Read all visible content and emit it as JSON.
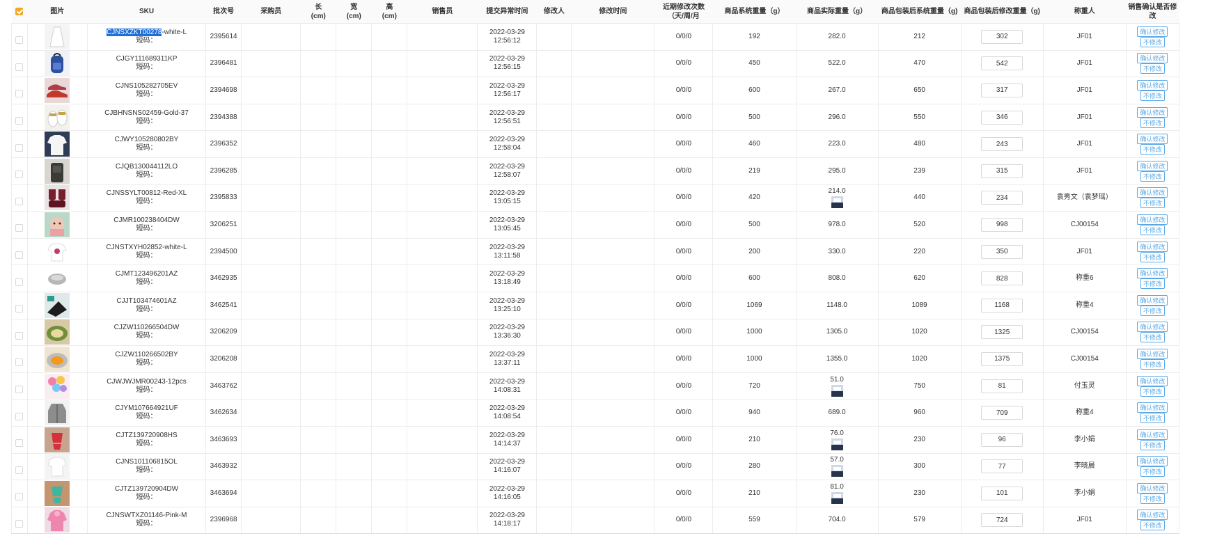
{
  "headers": {
    "image": "图片",
    "sku": "SKU",
    "batch": "批次号",
    "buyer": "采购员",
    "length": "长\n(cm)",
    "width": "宽\n(cm)",
    "height": "高\n(cm)",
    "seller": "销售员",
    "submit_time": "提交异常时间",
    "modifier": "修改人",
    "modify_time": "修改时间",
    "recent_count": "近期修改次数（天/周/月",
    "sys_weight": "商品系统重量（g）",
    "actual_weight": "商品实际重量（g）",
    "pkg_sys_weight": "商品包装后系统重量（g)",
    "pkg_mod_weight": "商品包装后修改重量（g)",
    "weigher": "称重人",
    "confirm": "销售确认是否修改"
  },
  "labels": {
    "short_code": "短码：",
    "confirm_btn": "确认修改",
    "reject_btn": "不修改"
  },
  "colors": {
    "accent": "#f5a623",
    "link": "#5aa9e6",
    "highlight": "#1e6fd9"
  },
  "rows": [
    {
      "sku_hl": "CJNSXZKT00278",
      "sku_rest": "-white-L",
      "batch": "2395614",
      "date": "2022-03-29",
      "time": "12:56:12",
      "count": "0/0/0",
      "sys": "192",
      "actual": "282.0",
      "pkg_sys": "212",
      "pkg_mod": "302",
      "weigher": "JF01",
      "img": "dress-icon",
      "has_mini": false
    },
    {
      "sku_hl": "",
      "sku_rest": "CJGY111689311KP",
      "batch": "2396481",
      "date": "2022-03-29",
      "time": "12:56:15",
      "count": "0/0/0",
      "sys": "450",
      "actual": "522.0",
      "pkg_sys": "470",
      "pkg_mod": "542",
      "weigher": "JF01",
      "img": "backpack-icon",
      "has_mini": false
    },
    {
      "sku_hl": "",
      "sku_rest": "CJNS105282705EV",
      "batch": "2394698",
      "date": "2022-03-29",
      "time": "12:56:17",
      "count": "0/0/0",
      "sys": "600",
      "actual": "267.0",
      "pkg_sys": "650",
      "pkg_mod": "317",
      "weigher": "JF01",
      "img": "shoes-icon",
      "has_mini": false
    },
    {
      "sku_hl": "",
      "sku_rest": "CJBHNSNS02459-Gold-37",
      "batch": "2394388",
      "date": "2022-03-29",
      "time": "12:56:51",
      "count": "0/0/0",
      "sys": "500",
      "actual": "296.0",
      "pkg_sys": "550",
      "pkg_mod": "346",
      "weigher": "JF01",
      "img": "slippers-icon",
      "has_mini": false
    },
    {
      "sku_hl": "",
      "sku_rest": "CJWY105280802BY",
      "batch": "2396352",
      "date": "2022-03-29",
      "time": "12:58:04",
      "count": "0/0/0",
      "sys": "460",
      "actual": "223.0",
      "pkg_sys": "480",
      "pkg_mod": "243",
      "weigher": "JF01",
      "img": "shirt-icon",
      "has_mini": false
    },
    {
      "sku_hl": "",
      "sku_rest": "CJQB130044112LO",
      "batch": "2396285",
      "date": "2022-03-29",
      "time": "12:58:07",
      "count": "0/0/0",
      "sys": "219",
      "actual": "295.0",
      "pkg_sys": "239",
      "pkg_mod": "315",
      "weigher": "JF01",
      "img": "bag-icon",
      "has_mini": false
    },
    {
      "sku_hl": "",
      "sku_rest": "CJNSSYLT00812-Red-XL",
      "batch": "2395833",
      "date": "2022-03-29",
      "time": "13:05:15",
      "count": "0/0/0",
      "sys": "420",
      "actual": "214.0",
      "pkg_sys": "440",
      "pkg_mod": "234",
      "weigher": "袁秀文（袁梦瑶）",
      "img": "swimsuit-icon",
      "has_mini": true
    },
    {
      "sku_hl": "",
      "sku_rest": "CJMR100238404DW",
      "batch": "3206251",
      "date": "2022-03-29",
      "time": "13:05:45",
      "count": "0/0/0",
      "sys": "500",
      "actual": "978.0",
      "pkg_sys": "520",
      "pkg_mod": "998",
      "weigher": "CJ00154",
      "img": "toy-icon",
      "has_mini": false
    },
    {
      "sku_hl": "",
      "sku_rest": "CJNSTXYH02852-white-L",
      "batch": "2394500",
      "date": "2022-03-29",
      "time": "13:11:58",
      "count": "0/0/0",
      "sys": "200",
      "actual": "330.0",
      "pkg_sys": "220",
      "pkg_mod": "350",
      "weigher": "JF01",
      "img": "tshirt-icon",
      "has_mini": false
    },
    {
      "sku_hl": "",
      "sku_rest": "CJMT123496201AZ",
      "batch": "3462935",
      "date": "2022-03-29",
      "time": "13:18:49",
      "count": "0/0/0",
      "sys": "600",
      "actual": "808.0",
      "pkg_sys": "620",
      "pkg_mod": "828",
      "weigher": "称重6",
      "img": "mouse-icon",
      "has_mini": false
    },
    {
      "sku_hl": "",
      "sku_rest": "CJJT103474601AZ",
      "batch": "3462541",
      "date": "2022-03-29",
      "time": "13:25:10",
      "count": "0/0/0",
      "sys": "1069",
      "actual": "1148.0",
      "pkg_sys": "1089",
      "pkg_mod": "1168",
      "weigher": "称重4",
      "img": "pad-icon",
      "has_mini": false
    },
    {
      "sku_hl": "",
      "sku_rest": "CJZW110266504DW",
      "batch": "3206209",
      "date": "2022-03-29",
      "time": "13:36:30",
      "count": "0/0/0",
      "sys": "1000",
      "actual": "1305.0",
      "pkg_sys": "1020",
      "pkg_mod": "1325",
      "weigher": "CJ00154",
      "img": "pet-bed-icon",
      "has_mini": false
    },
    {
      "sku_hl": "",
      "sku_rest": "CJZW110266502BY",
      "batch": "3206208",
      "date": "2022-03-29",
      "time": "13:37:11",
      "count": "0/0/0",
      "sys": "1000",
      "actual": "1355.0",
      "pkg_sys": "1020",
      "pkg_mod": "1375",
      "weigher": "CJ00154",
      "img": "pet-bed-orange-icon",
      "has_mini": false
    },
    {
      "sku_hl": "",
      "sku_rest": "CJWJWJMR00243-12pcs",
      "batch": "3463762",
      "date": "2022-03-29",
      "time": "14:08:31",
      "count": "0/0/0",
      "sys": "720",
      "actual": "51.0",
      "pkg_sys": "750",
      "pkg_mod": "81",
      "weigher": "付玉灵",
      "img": "balloons-icon",
      "has_mini": true
    },
    {
      "sku_hl": "",
      "sku_rest": "CJYM107664921UF",
      "batch": "3462634",
      "date": "2022-03-29",
      "time": "14:08:54",
      "count": "0/0/0",
      "sys": "940",
      "actual": "689.0",
      "pkg_sys": "960",
      "pkg_mod": "709",
      "weigher": "称重4",
      "img": "coat-icon",
      "has_mini": false
    },
    {
      "sku_hl": "",
      "sku_rest": "CJTZ139720908HS",
      "batch": "3463693",
      "date": "2022-03-29",
      "time": "14:14:37",
      "count": "0/0/0",
      "sys": "210",
      "actual": "76.0",
      "pkg_sys": "230",
      "pkg_mod": "96",
      "weigher": "李小娟",
      "img": "lingerie-red-icon",
      "has_mini": true
    },
    {
      "sku_hl": "",
      "sku_rest": "CJNS101106815OL",
      "batch": "3463932",
      "date": "2022-03-29",
      "time": "14:16:07",
      "count": "0/0/0",
      "sys": "280",
      "actual": "57.0",
      "pkg_sys": "300",
      "pkg_mod": "77",
      "weigher": "李晓晨",
      "img": "white-top-icon",
      "has_mini": true
    },
    {
      "sku_hl": "",
      "sku_rest": "CJTZ139720904DW",
      "batch": "3463694",
      "date": "2022-03-29",
      "time": "14:16:05",
      "count": "0/0/0",
      "sys": "210",
      "actual": "81.0",
      "pkg_sys": "230",
      "pkg_mod": "101",
      "weigher": "李小娟",
      "img": "lingerie-green-icon",
      "has_mini": true
    },
    {
      "sku_hl": "",
      "sku_rest": "CJNSWTXZ01146-Pink-M",
      "batch": "2396968",
      "date": "2022-03-29",
      "time": "14:18:17",
      "count": "0/0/0",
      "sys": "559",
      "actual": "704.0",
      "pkg_sys": "579",
      "pkg_mod": "724",
      "weigher": "JF01",
      "img": "pink-hoodie-icon",
      "has_mini": false
    }
  ]
}
